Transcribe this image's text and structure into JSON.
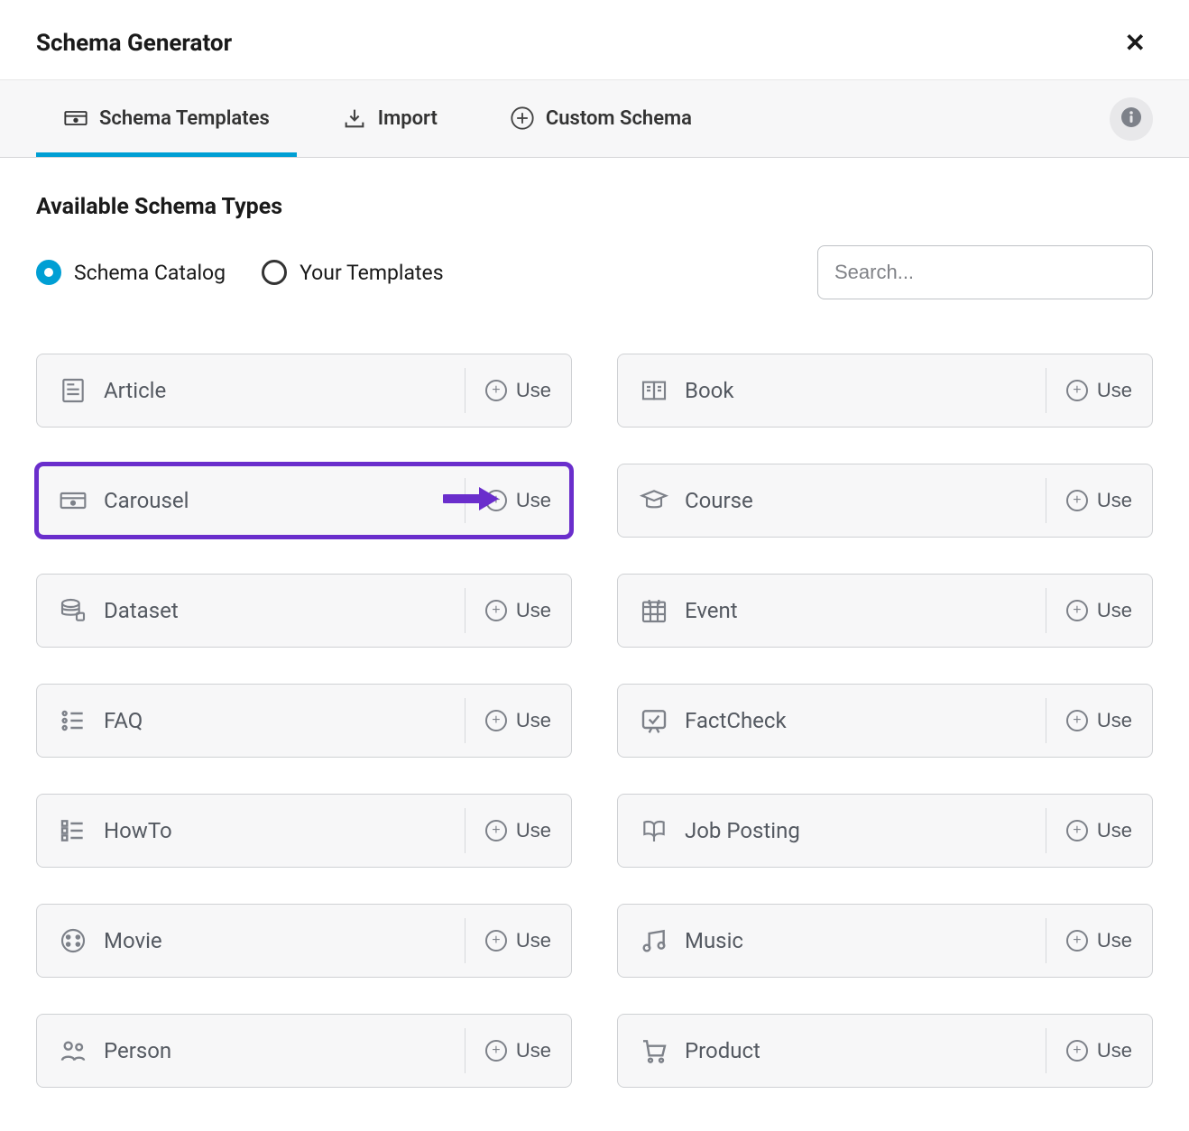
{
  "header": {
    "title": "Schema Generator"
  },
  "tabs": {
    "schema_templates": "Schema Templates",
    "import": "Import",
    "custom_schema": "Custom Schema"
  },
  "section_title": "Available Schema Types",
  "radios": {
    "catalog": "Schema Catalog",
    "your_templates": "Your Templates"
  },
  "search": {
    "placeholder": "Search..."
  },
  "use_label": "Use",
  "cards": {
    "article": "Article",
    "book": "Book",
    "carousel": "Carousel",
    "course": "Course",
    "dataset": "Dataset",
    "event": "Event",
    "faq": "FAQ",
    "factcheck": "FactCheck",
    "howto": "HowTo",
    "jobposting": "Job Posting",
    "movie": "Movie",
    "music": "Music",
    "person": "Person",
    "product": "Product"
  }
}
